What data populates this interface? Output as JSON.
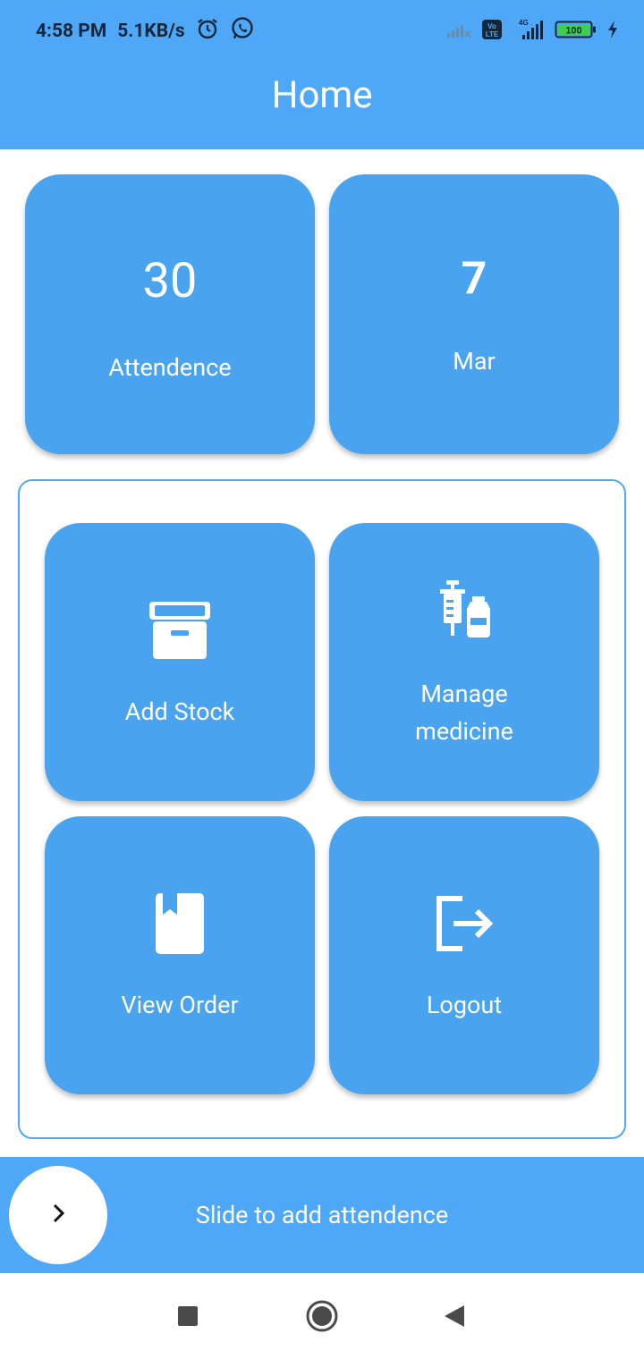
{
  "status_bar": {
    "time": "4:58 PM",
    "network_speed": "5.1KB/s",
    "battery": "100",
    "icons": [
      "alarm-icon",
      "whatsapp-icon",
      "signal-icon",
      "volte-icon",
      "4g-signal-icon",
      "battery-icon",
      "charging-icon"
    ],
    "volte_label": "Vo LTE",
    "net_type": "4G"
  },
  "app_bar": {
    "title": "Home"
  },
  "stats": {
    "attendance": {
      "value": "30",
      "label": "Attendence"
    },
    "date": {
      "day": "7",
      "month": "Mar"
    }
  },
  "menu": {
    "add_stock": {
      "label": "Add Stock",
      "icon": "archive-box-icon"
    },
    "manage_medicine": {
      "label_line1": "Manage",
      "label_line2": "medicine",
      "icon": "syringe-vial-icon"
    },
    "view_order": {
      "label": "View Order",
      "icon": "book-icon"
    },
    "logout": {
      "label": "Logout",
      "icon": "logout-icon"
    }
  },
  "slider": {
    "label": "Slide to add attendence",
    "icon": "chevron-right-icon"
  },
  "nav": {
    "icons": [
      "recents-square-icon",
      "home-circle-icon",
      "back-triangle-icon"
    ]
  },
  "colors": {
    "primary": "#4ea8f7",
    "card": "#4aa3ef",
    "text_on_primary": "#ffffff",
    "status_text": "#16263a"
  }
}
